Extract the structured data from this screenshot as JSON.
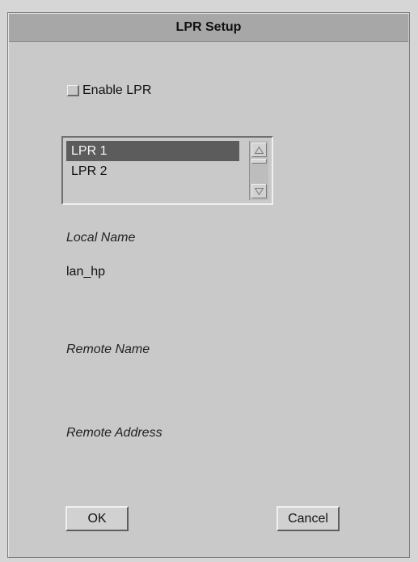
{
  "window": {
    "title": "LPR Setup"
  },
  "enable": {
    "label": "Enable LPR",
    "checked": false
  },
  "list": {
    "items": [
      "LPR 1",
      "LPR 2"
    ],
    "selected_index": 0
  },
  "fields": {
    "local_name_label": "Local Name",
    "local_name_value": "lan_hp",
    "remote_name_label": "Remote Name",
    "remote_name_value": "",
    "remote_address_label": "Remote Address",
    "remote_address_value": ""
  },
  "buttons": {
    "ok": "OK",
    "cancel": "Cancel"
  },
  "icons": {
    "scroll_up": "triangle-up-icon",
    "scroll_down": "triangle-down-icon"
  },
  "colors": {
    "selection": "#5c5c5c",
    "panel": "#c9c9c9",
    "titlebar": "#a7a7a7"
  }
}
